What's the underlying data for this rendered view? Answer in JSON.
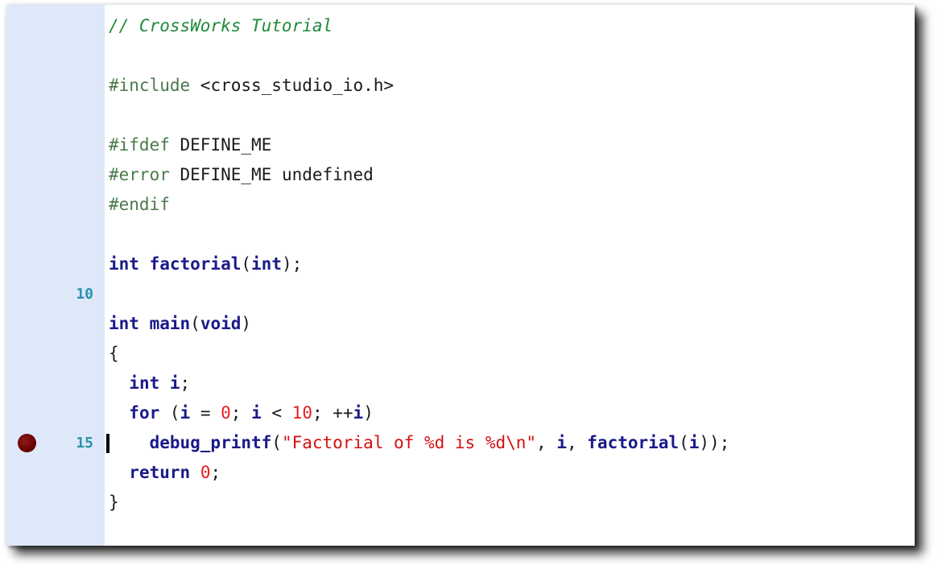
{
  "editor": {
    "lines": [
      {
        "tokens": [
          {
            "t": "cm",
            "v": "// CrossWorks Tutorial"
          }
        ]
      },
      {
        "tokens": []
      },
      {
        "tokens": [
          {
            "t": "pp",
            "v": "#include "
          },
          {
            "t": "pl",
            "v": "<cross_studio_io.h>"
          }
        ]
      },
      {
        "tokens": []
      },
      {
        "tokens": [
          {
            "t": "pp",
            "v": "#ifdef "
          },
          {
            "t": "pl",
            "v": "DEFINE_ME"
          }
        ]
      },
      {
        "tokens": [
          {
            "t": "pp",
            "v": "#error "
          },
          {
            "t": "pl",
            "v": "DEFINE_ME undefined"
          }
        ]
      },
      {
        "tokens": [
          {
            "t": "pp",
            "v": "#endif"
          }
        ]
      },
      {
        "tokens": []
      },
      {
        "tokens": [
          {
            "t": "kw",
            "v": "int "
          },
          {
            "t": "kw",
            "v": "factorial"
          },
          {
            "t": "pl",
            "v": "("
          },
          {
            "t": "kw",
            "v": "int"
          },
          {
            "t": "pl",
            "v": ");"
          }
        ]
      },
      {
        "num": "10",
        "tokens": []
      },
      {
        "tokens": [
          {
            "t": "kw",
            "v": "int "
          },
          {
            "t": "kw",
            "v": "main"
          },
          {
            "t": "pl",
            "v": "("
          },
          {
            "t": "kw",
            "v": "void"
          },
          {
            "t": "pl",
            "v": ")"
          }
        ]
      },
      {
        "tokens": [
          {
            "t": "pl",
            "v": "{"
          }
        ]
      },
      {
        "tokens": [
          {
            "t": "pl",
            "v": "  "
          },
          {
            "t": "kw",
            "v": "int "
          },
          {
            "t": "kw",
            "v": "i"
          },
          {
            "t": "pl",
            "v": ";"
          }
        ]
      },
      {
        "tokens": [
          {
            "t": "pl",
            "v": "  "
          },
          {
            "t": "kw",
            "v": "for "
          },
          {
            "t": "pl",
            "v": "("
          },
          {
            "t": "kw",
            "v": "i"
          },
          {
            "t": "pl",
            "v": " = "
          },
          {
            "t": "num",
            "v": "0"
          },
          {
            "t": "pl",
            "v": "; "
          },
          {
            "t": "kw",
            "v": "i"
          },
          {
            "t": "pl",
            "v": " < "
          },
          {
            "t": "num",
            "v": "10"
          },
          {
            "t": "pl",
            "v": "; ++"
          },
          {
            "t": "kw",
            "v": "i"
          },
          {
            "t": "pl",
            "v": ")"
          }
        ]
      },
      {
        "num": "15",
        "breakpoint": true,
        "cursor": true,
        "tokens": [
          {
            "t": "pl",
            "v": "    "
          },
          {
            "t": "kw",
            "v": "debug_printf"
          },
          {
            "t": "pl",
            "v": "("
          },
          {
            "t": "str",
            "v": "\"Factorial of %d is %d\\n\""
          },
          {
            "t": "pl",
            "v": ", "
          },
          {
            "t": "kw",
            "v": "i"
          },
          {
            "t": "pl",
            "v": ", "
          },
          {
            "t": "kw",
            "v": "factorial"
          },
          {
            "t": "pl",
            "v": "("
          },
          {
            "t": "kw",
            "v": "i"
          },
          {
            "t": "pl",
            "v": "));"
          }
        ]
      },
      {
        "tokens": [
          {
            "t": "pl",
            "v": "  "
          },
          {
            "t": "kw",
            "v": "return "
          },
          {
            "t": "num",
            "v": "0"
          },
          {
            "t": "pl",
            "v": ";"
          }
        ]
      },
      {
        "tokens": [
          {
            "t": "pl",
            "v": "}"
          }
        ]
      }
    ]
  },
  "colors": {
    "gutter": "#dfe8f8",
    "line_number": "#2b91af",
    "comment": "#1f8a3a",
    "preprocessor": "#4a7a4a",
    "keyword": "#1a1a8a",
    "number": "#e81c1c",
    "string": "#d41010",
    "breakpoint": "#6b0000"
  }
}
